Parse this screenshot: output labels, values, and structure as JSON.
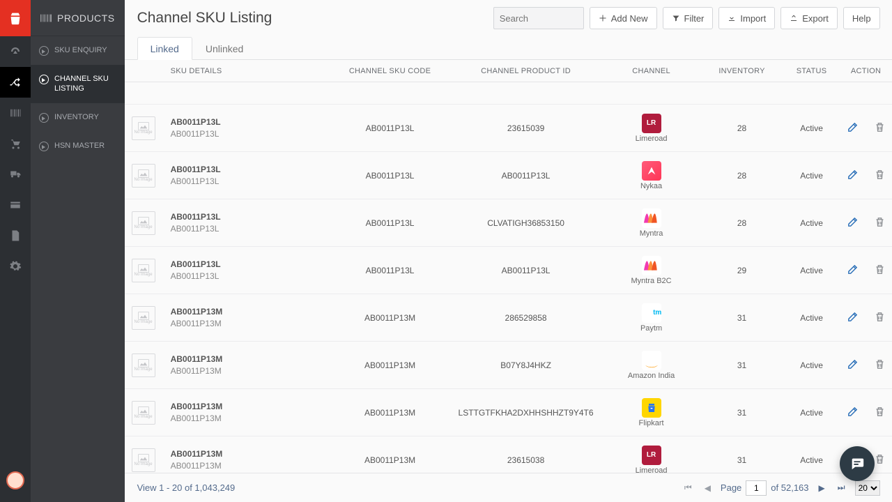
{
  "app": {
    "section_title": "PRODUCTS",
    "page_title": "Channel SKU Listing"
  },
  "sidebar": {
    "items": [
      {
        "label": "SKU ENQUIRY",
        "active": false
      },
      {
        "label": "CHANNEL SKU LISTING",
        "active": true
      },
      {
        "label": "INVENTORY",
        "active": false
      },
      {
        "label": "HSN MASTER",
        "active": false
      }
    ]
  },
  "toolbar": {
    "search_placeholder": "Search",
    "add_label": "Add New",
    "filter_label": "Filter",
    "import_label": "Import",
    "export_label": "Export",
    "help_label": "Help"
  },
  "tabs": {
    "linked": "Linked",
    "unlinked": "Unlinked",
    "active": "linked"
  },
  "columns": {
    "sku": "SKU DETAILS",
    "code": "CHANNEL SKU CODE",
    "pid": "CHANNEL PRODUCT ID",
    "channel": "CHANNEL",
    "inventory": "INVENTORY",
    "status": "STATUS",
    "action": "ACTION"
  },
  "rows": [
    {
      "sku_main": "AB0011P13L",
      "sku_sub": "AB0011P13L",
      "code": "AB0011P13L",
      "pid": "23615039",
      "channel": "Limeroad",
      "channel_key": "limeroad",
      "inventory": "28",
      "status": "Active"
    },
    {
      "sku_main": "AB0011P13L",
      "sku_sub": "AB0011P13L",
      "code": "AB0011P13L",
      "pid": "AB0011P13L",
      "channel": "Nykaa",
      "channel_key": "nykaa",
      "inventory": "28",
      "status": "Active"
    },
    {
      "sku_main": "AB0011P13L",
      "sku_sub": "AB0011P13L",
      "code": "AB0011P13L",
      "pid": "CLVATIGH36853150",
      "channel": "Myntra",
      "channel_key": "myntra",
      "inventory": "28",
      "status": "Active"
    },
    {
      "sku_main": "AB0011P13L",
      "sku_sub": "AB0011P13L",
      "code": "AB0011P13L",
      "pid": "AB0011P13L",
      "channel": "Myntra B2C",
      "channel_key": "myntra",
      "inventory": "29",
      "status": "Active"
    },
    {
      "sku_main": "AB0011P13M",
      "sku_sub": "AB0011P13M",
      "code": "AB0011P13M",
      "pid": "286529858",
      "channel": "Paytm",
      "channel_key": "paytm",
      "inventory": "31",
      "status": "Active"
    },
    {
      "sku_main": "AB0011P13M",
      "sku_sub": "AB0011P13M",
      "code": "AB0011P13M",
      "pid": "B07Y8J4HKZ",
      "channel": "Amazon India",
      "channel_key": "amazon",
      "inventory": "31",
      "status": "Active"
    },
    {
      "sku_main": "AB0011P13M",
      "sku_sub": "AB0011P13M",
      "code": "AB0011P13M",
      "pid": "LSTTGTFKHA2DXHHSHHZT9Y4T6",
      "channel": "Flipkart",
      "channel_key": "flipkart",
      "inventory": "31",
      "status": "Active"
    },
    {
      "sku_main": "AB0011P13M",
      "sku_sub": "AB0011P13M",
      "code": "AB0011P13M",
      "pid": "23615038",
      "channel": "Limeroad",
      "channel_key": "limeroad",
      "inventory": "31",
      "status": "Active"
    }
  ],
  "pager": {
    "view_text": "View 1 - 20 of 1,043,249",
    "page_label": "Page",
    "page_value": "1",
    "of_text": "of 52,163",
    "page_size": "20"
  }
}
